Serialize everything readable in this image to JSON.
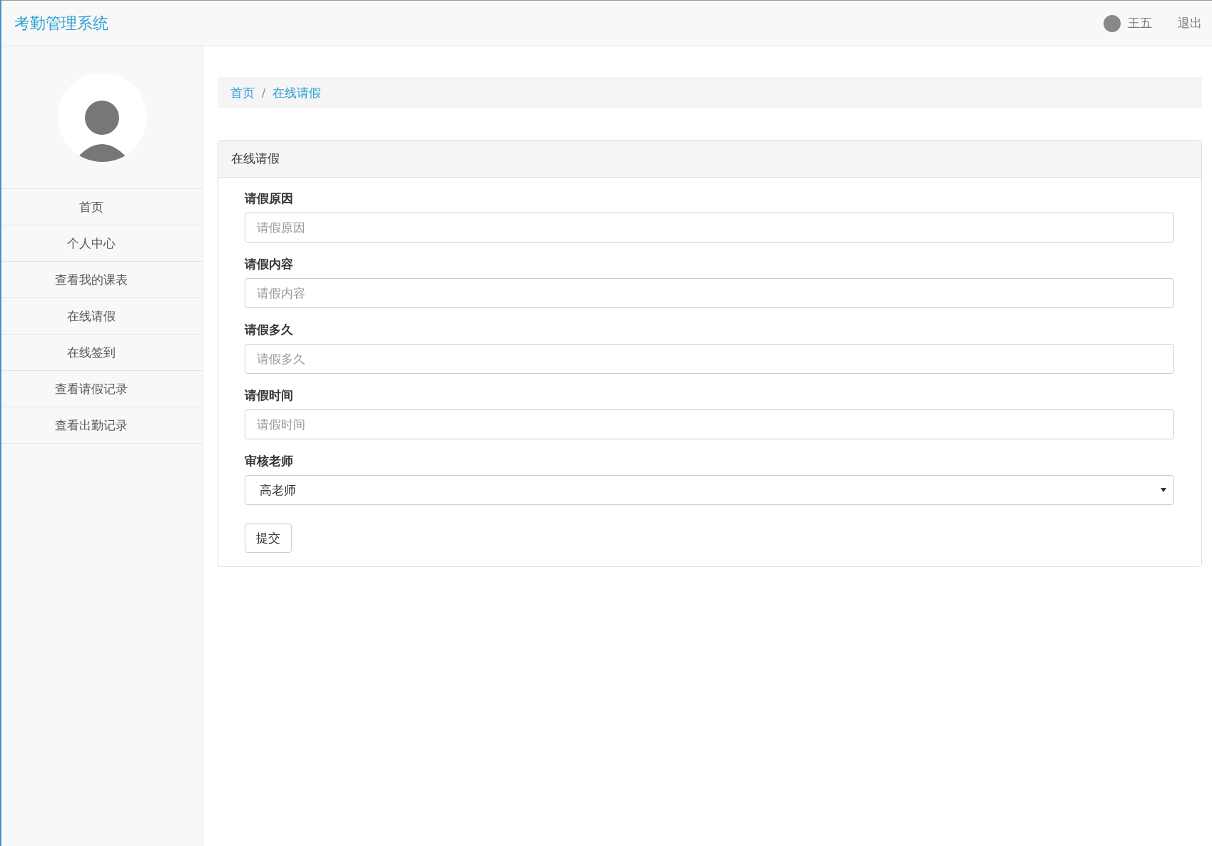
{
  "header": {
    "brand": "考勤管理系统",
    "user_name": "王五",
    "logout": "退出"
  },
  "sidebar": {
    "items": [
      "首页",
      "个人中心",
      "查看我的课表",
      "在线请假",
      "在线签到",
      "查看请假记录",
      "查看出勤记录"
    ]
  },
  "breadcrumb": {
    "separator": "/",
    "items": [
      "首页",
      "在线请假"
    ]
  },
  "panel": {
    "title": "在线请假",
    "fields": [
      {
        "kind": "text",
        "label": "请假原因",
        "placeholder": "请假原因"
      },
      {
        "kind": "text",
        "label": "请假内容",
        "placeholder": "请假内容"
      },
      {
        "kind": "text",
        "label": "请假多久",
        "placeholder": "请假多久"
      },
      {
        "kind": "text",
        "label": "请假时间",
        "placeholder": "请假时间"
      },
      {
        "kind": "select",
        "label": "审核老师",
        "value": "高老师"
      }
    ],
    "submit": "提交"
  }
}
